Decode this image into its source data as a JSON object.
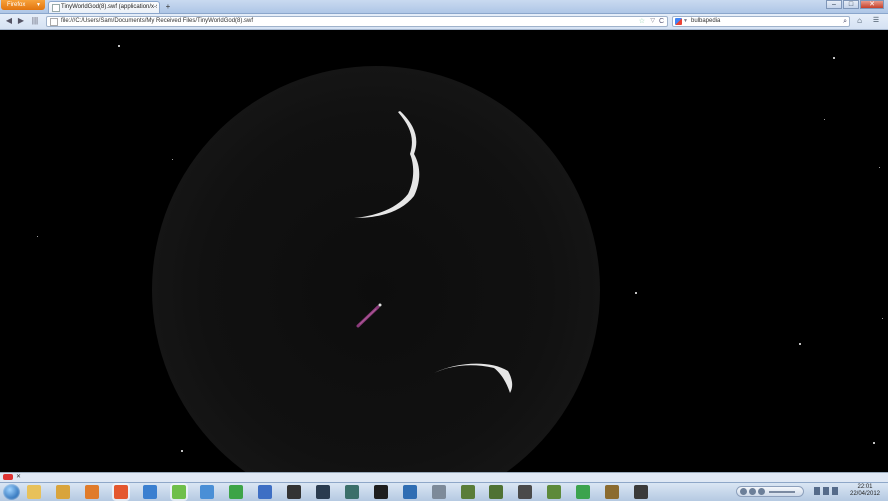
{
  "browser": {
    "app_button_label": "Firefox",
    "app_button_arrow": "▼",
    "tab": {
      "title": "TinyWorldGod(8).swf (application/x-sho...",
      "favicon": "page-icon"
    },
    "new_tab_label": "+",
    "window_controls": {
      "minimize": "–",
      "maximize": "□",
      "close": "✕"
    },
    "nav": {
      "back": "◀",
      "forward": "▶",
      "history": "|||"
    },
    "url": "file:///C:/Users/Sam/Documents/My Received Files/TinyWorldGod(8).swf",
    "url_icons": {
      "bookmark": "☆",
      "dropdown": "▽",
      "reload": "C"
    },
    "search": {
      "engine": "google-icon",
      "dropdown": "▼",
      "value": "bulbapedia",
      "go": "⌕"
    },
    "home": "⌂",
    "menu": "☰"
  },
  "game": {
    "planet": "dark-planet",
    "figures": [
      "white-worm-top",
      "white-worm-bottom",
      "purple-creature"
    ]
  },
  "notification_strip": {
    "close": "✕"
  },
  "taskbar": {
    "pinned": [
      {
        "name": "windows-explorer-icon",
        "color": "#e8c15a"
      },
      {
        "name": "folder-icon",
        "color": "#d9a43c"
      },
      {
        "name": "media-player-icon",
        "color": "#e07b2a"
      },
      {
        "name": "firefox-icon",
        "color": "#e4572e"
      },
      {
        "name": "itunes-icon",
        "color": "#3a7fd0"
      },
      {
        "name": "messenger-icon",
        "color": "#6fbf4a"
      },
      {
        "name": "windows-live-icon",
        "color": "#4a8fd6"
      },
      {
        "name": "utorrent-icon",
        "color": "#3da447"
      },
      {
        "name": "game-launcher-icon",
        "color": "#3e6fc4"
      },
      {
        "name": "app-icon-dark",
        "color": "#333333"
      },
      {
        "name": "steam-icon",
        "color": "#2a3b4f"
      },
      {
        "name": "app-icon-teal",
        "color": "#3b6f6a"
      },
      {
        "name": "app-icon-black",
        "color": "#1e1e1e"
      },
      {
        "name": "app-icon-blue",
        "color": "#2f6db3"
      },
      {
        "name": "app-icon-grey",
        "color": "#7d8a99"
      },
      {
        "name": "minecraft-icon",
        "color": "#5a7d38"
      },
      {
        "name": "minecraft-icon-2",
        "color": "#4f7233"
      },
      {
        "name": "app-icon-cube",
        "color": "#4a4a4a"
      },
      {
        "name": "app-icon-ruby",
        "color": "#5d8a3a"
      },
      {
        "name": "app-icon-green",
        "color": "#3ca34d"
      },
      {
        "name": "warcraft-icon",
        "color": "#8b6b2f"
      },
      {
        "name": "world-of-tanks-icon",
        "color": "#3a3a3a"
      }
    ],
    "clock": {
      "time": "22:01",
      "date": "22/04/2012"
    }
  }
}
